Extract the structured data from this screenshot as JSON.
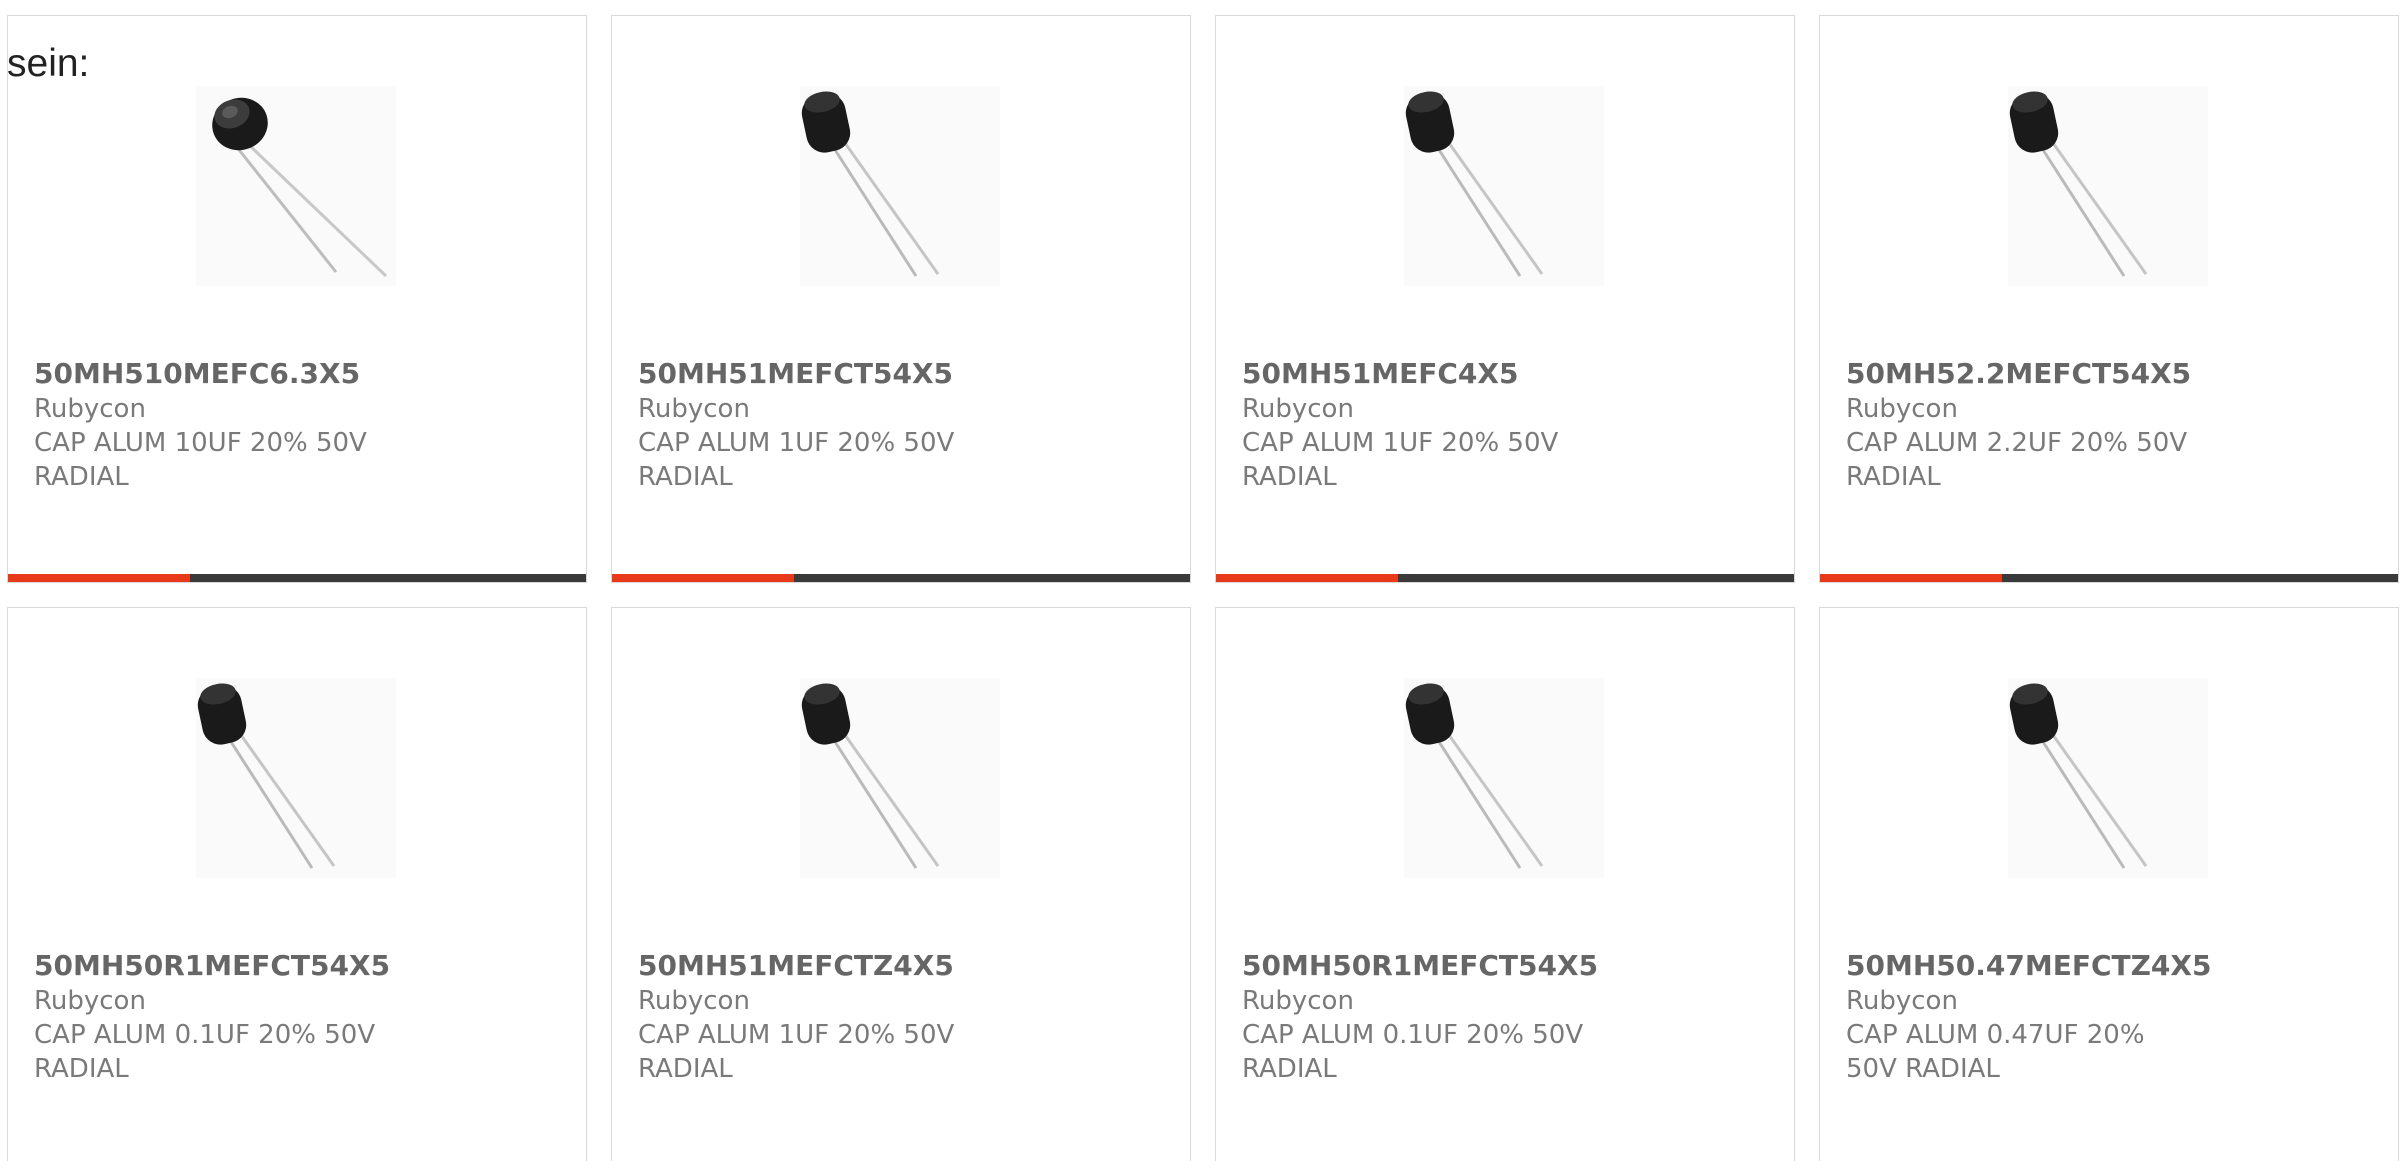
{
  "intro_text": "sein:",
  "colors": {
    "accent": "#e8391a",
    "bar": "#3a3a3a",
    "border": "#d9d9d9",
    "text": "#7a7a7a"
  },
  "products": [
    {
      "part": "50MH510MEFC6.3X5",
      "maker": "Rubycon",
      "desc": "CAP ALUM 10UF 20% 50V RADIAL",
      "image_icon": "capacitor-image"
    },
    {
      "part": "50MH51MEFCT54X5",
      "maker": "Rubycon",
      "desc": "CAP ALUM 1UF 20% 50V RADIAL",
      "image_icon": "capacitor-image"
    },
    {
      "part": "50MH51MEFC4X5",
      "maker": "Rubycon",
      "desc": "CAP ALUM 1UF 20% 50V RADIAL",
      "image_icon": "capacitor-image"
    },
    {
      "part": "50MH52.2MEFCT54X5",
      "maker": "Rubycon",
      "desc": "CAP ALUM 2.2UF 20% 50V RADIAL",
      "image_icon": "capacitor-image"
    },
    {
      "part": "50MH50R1MEFCT54X5",
      "maker": "Rubycon",
      "desc": "CAP ALUM 0.1UF 20% 50V RADIAL",
      "image_icon": "capacitor-image"
    },
    {
      "part": "50MH51MEFCTZ4X5",
      "maker": "Rubycon",
      "desc": "CAP ALUM 1UF 20% 50V RADIAL",
      "image_icon": "capacitor-image"
    },
    {
      "part": "50MH50R1MEFCT54X5",
      "maker": "Rubycon",
      "desc": "CAP ALUM 0.1UF 20% 50V RADIAL",
      "image_icon": "capacitor-image"
    },
    {
      "part": "50MH50.47MEFCTZ4X5",
      "maker": "Rubycon",
      "desc": "CAP ALUM 0.47UF 20% 50V RADIAL",
      "image_icon": "capacitor-image"
    }
  ]
}
